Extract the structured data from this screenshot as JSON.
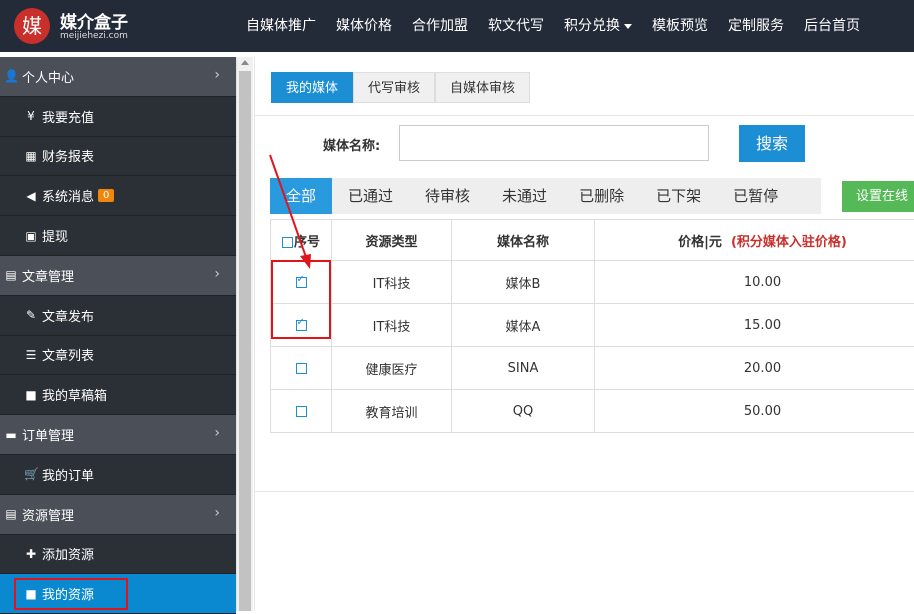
{
  "header": {
    "logo_char": "媒",
    "logo_name": "媒介盒子",
    "logo_sub": "meijiehezi.com",
    "nav": [
      "自媒体推广",
      "媒体价格",
      "合作加盟",
      "软文代写",
      "积分兑换",
      "模板预览",
      "定制服务",
      "后台首页"
    ]
  },
  "sidebar": {
    "items": [
      {
        "label": "个人中心",
        "icon": "user-icon",
        "type": "head"
      },
      {
        "label": "我要充值",
        "icon": "yen-icon",
        "type": "sub"
      },
      {
        "label": "财务报表",
        "icon": "grid-icon",
        "type": "sub"
      },
      {
        "label": "系统消息",
        "icon": "speaker-icon",
        "type": "sub",
        "badge": "0"
      },
      {
        "label": "提现",
        "icon": "money-icon",
        "type": "sub"
      },
      {
        "label": "文章管理",
        "icon": "book-icon",
        "type": "head"
      },
      {
        "label": "文章发布",
        "icon": "edit-icon",
        "type": "sub"
      },
      {
        "label": "文章列表",
        "icon": "list-icon",
        "type": "sub"
      },
      {
        "label": "我的草稿箱",
        "icon": "video-icon",
        "type": "sub"
      },
      {
        "label": "订单管理",
        "icon": "folder-icon",
        "type": "head"
      },
      {
        "label": "我的订单",
        "icon": "cart-icon",
        "type": "sub"
      },
      {
        "label": "资源管理",
        "icon": "resource-icon",
        "type": "head"
      },
      {
        "label": "添加资源",
        "icon": "plus-icon",
        "type": "sub"
      },
      {
        "label": "我的资源",
        "icon": "video-icon",
        "type": "sub",
        "active": true
      }
    ]
  },
  "main": {
    "tabs": [
      "我的媒体",
      "代写审核",
      "自媒体审核"
    ],
    "search_label": "媒体名称:",
    "search_value": "",
    "search_button": "搜索",
    "filters": [
      "全部",
      "已通过",
      "待审核",
      "未通过",
      "已删除",
      "已下架",
      "已暂停"
    ],
    "online_button": "设置在线",
    "table": {
      "headers": [
        "序号",
        "资源类型",
        "媒体名称",
        "价格|元",
        "(积分媒体入驻价格)"
      ],
      "rows": [
        {
          "checked": true,
          "type": "IT科技",
          "name": "媒体B",
          "price": "10.00"
        },
        {
          "checked": true,
          "type": "IT科技",
          "name": "媒体A",
          "price": "15.00"
        },
        {
          "checked": false,
          "type": "健康医疗",
          "name": "SINA",
          "price": "20.00"
        },
        {
          "checked": false,
          "type": "教育培训",
          "name": "QQ",
          "price": "50.00"
        }
      ]
    }
  },
  "colors": {
    "topbar": "#232a38",
    "accent": "#1c8ed4",
    "highlight": "#e0151b",
    "success": "#56b957"
  }
}
